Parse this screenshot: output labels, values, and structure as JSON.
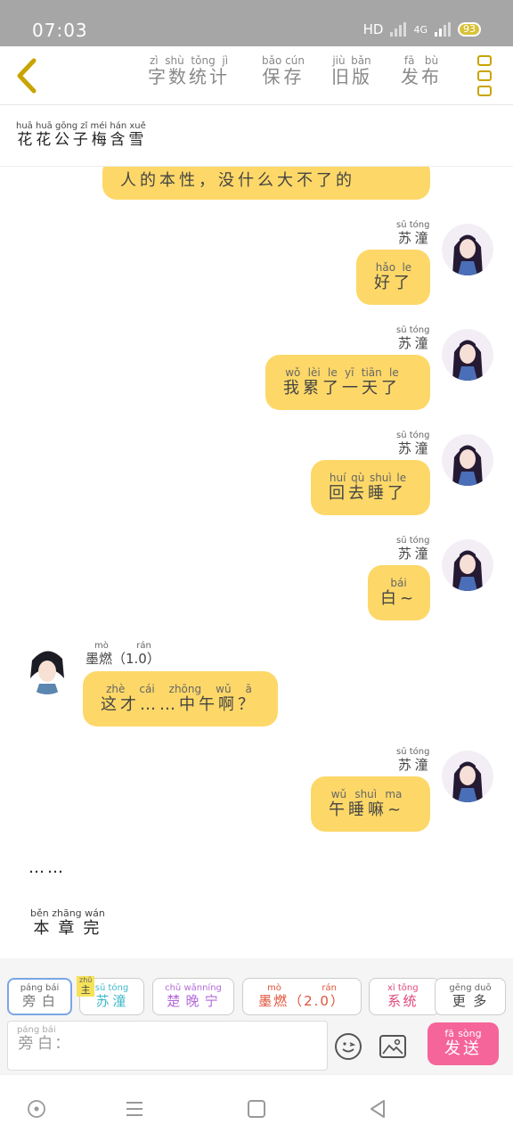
{
  "status": {
    "time": "07:03",
    "hd": "HD",
    "network": "4G",
    "battery": "93"
  },
  "topbar": {
    "items": [
      {
        "text": "字数统计",
        "pinyin": "zì shù tǒng jì"
      },
      {
        "text": "保存",
        "pinyin": "bǎo cún"
      },
      {
        "text": "旧版",
        "pinyin": "jiù bǎn"
      },
      {
        "text": "发布",
        "pinyin": "fā bù"
      }
    ]
  },
  "chat": {
    "title": "花花公子梅含雪",
    "title_pinyin": "huā huā gōng zǐ méi hán xuě",
    "messages": [
      {
        "speaker": "",
        "speaker_pinyin": "",
        "text": "人的本性，没什么大不了的",
        "pinyin": ""
      },
      {
        "speaker": "苏潼",
        "speaker_pinyin": "sū tóng",
        "text": "好了",
        "pinyin": "hǎo le"
      },
      {
        "speaker": "苏潼",
        "speaker_pinyin": "sū tóng",
        "text": "我累了一天了",
        "pinyin": "wǒ lèi le yī tiān le"
      },
      {
        "speaker": "苏潼",
        "speaker_pinyin": "sū tóng",
        "text": "回去睡了",
        "pinyin": "huí qù shuì le"
      },
      {
        "speaker": "苏潼",
        "speaker_pinyin": "sū tóng",
        "text": "白~",
        "pinyin": "bái"
      },
      {
        "speaker": "墨燃（1.0）",
        "speaker_pinyin": "mò rán",
        "text": "这才……中午啊？",
        "pinyin": "zhè cái zhōng wǔ ā"
      },
      {
        "speaker": "苏潼",
        "speaker_pinyin": "sū tóng",
        "text": "午睡嘛~",
        "pinyin": "wǔ shuì ma"
      }
    ],
    "ellipsis": "……",
    "end_text": "本章完",
    "end_pinyin": "běn zhāng wán"
  },
  "roles": [
    {
      "text": "旁白",
      "pinyin": "páng bái",
      "color": "#777777"
    },
    {
      "text": "苏潼",
      "pinyin": "sū tóng",
      "color": "#3fb8c9"
    },
    {
      "text": "楚晚宁",
      "pinyin": "chǔ wǎnníng",
      "color": "#b36ad9"
    },
    {
      "text": "墨燃（2.0）",
      "pinyin": "mò rán",
      "color": "#e0533a"
    },
    {
      "text": "系统",
      "pinyin": "xì tǒng",
      "color": "#e0487e"
    },
    {
      "text": "更多",
      "pinyin": "gēng duō",
      "color": "#444444"
    }
  ],
  "main_tag": "主",
  "main_tag_pinyin": "zhǔ",
  "input": {
    "label": "旁白",
    "label_pinyin": "páng bái",
    "colon": "："
  },
  "send": {
    "text": "发送",
    "pinyin": "fā sòng"
  },
  "colors": {
    "bubble": "#fdd868",
    "send": "#f5659a",
    "accent": "#c9a400"
  }
}
